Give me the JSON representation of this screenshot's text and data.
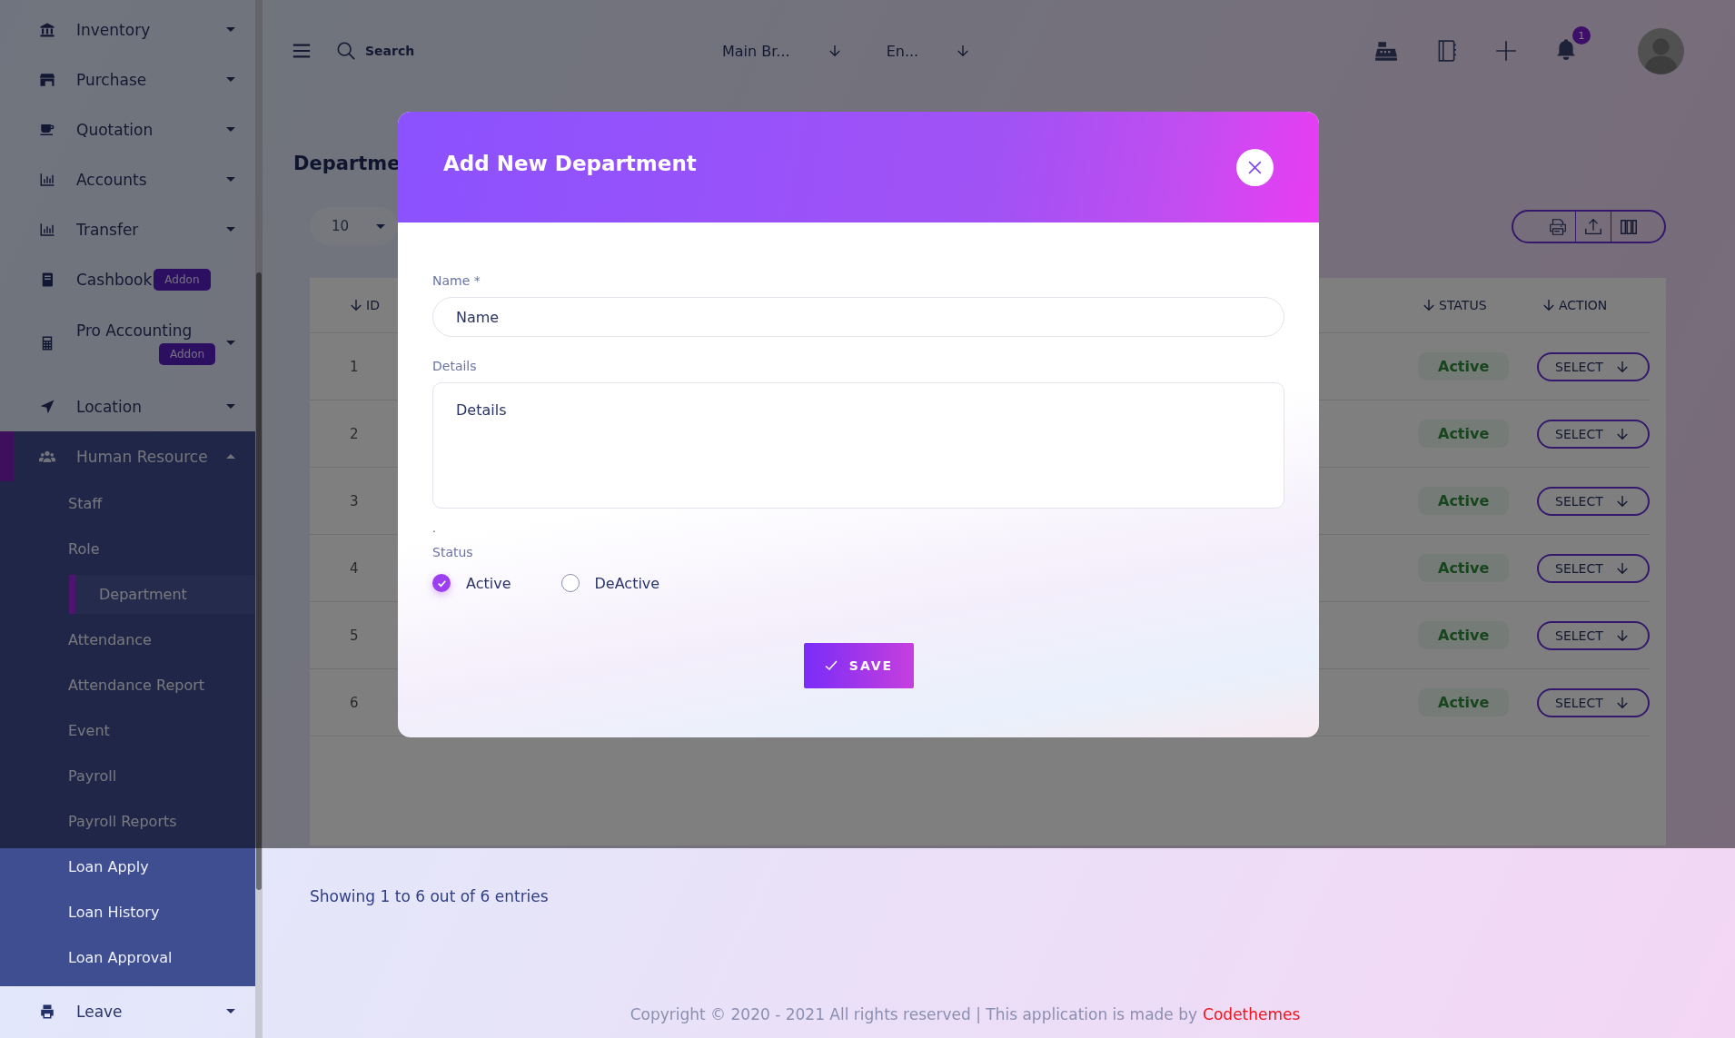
{
  "sidebar": {
    "items": [
      {
        "label": "Inventory",
        "kind": "menu",
        "expanded": false
      },
      {
        "label": "Purchase",
        "kind": "menu",
        "expanded": false
      },
      {
        "label": "Quotation",
        "kind": "menu",
        "expanded": false
      },
      {
        "label": "Accounts",
        "kind": "menu",
        "expanded": false
      },
      {
        "label": "Transfer",
        "kind": "menu",
        "expanded": false
      },
      {
        "label": "Cashbook",
        "kind": "link",
        "badge": "Addon"
      },
      {
        "label": "Pro Accounting",
        "kind": "menu",
        "expanded": false,
        "badge": "Addon"
      },
      {
        "label": "Location",
        "kind": "menu",
        "expanded": false
      },
      {
        "label": "Human Resource",
        "kind": "menu",
        "expanded": true,
        "children": [
          {
            "label": "Staff",
            "selected": false
          },
          {
            "label": "Role",
            "selected": false
          },
          {
            "label": "Department",
            "selected": true
          },
          {
            "label": "Attendance",
            "selected": false
          },
          {
            "label": "Attendance Report",
            "selected": false
          },
          {
            "label": "Event",
            "selected": false
          },
          {
            "label": "Payroll",
            "selected": false
          },
          {
            "label": "Payroll Reports",
            "selected": false
          },
          {
            "label": "Loan Apply",
            "selected": false
          },
          {
            "label": "Loan History",
            "selected": false
          },
          {
            "label": "Loan Approval",
            "selected": false
          }
        ]
      },
      {
        "label": "Leave",
        "kind": "menu",
        "expanded": false
      }
    ]
  },
  "topbar": {
    "search": {
      "placeholder": "Search"
    },
    "selects": [
      "Main Br...",
      "En..."
    ],
    "notification_count": "1"
  },
  "page_title": "Departme",
  "table": {
    "page_length": "10",
    "columns": [
      "ID",
      "STATUS",
      "ACTION"
    ],
    "rows": [
      {
        "id": "1",
        "status": "Active",
        "action": "SELECT"
      },
      {
        "id": "2",
        "status": "Active",
        "action": "SELECT"
      },
      {
        "id": "3",
        "status": "Active",
        "action": "SELECT"
      },
      {
        "id": "4",
        "status": "Active",
        "action": "SELECT"
      },
      {
        "id": "5",
        "status": "Active",
        "action": "SELECT"
      },
      {
        "id": "6",
        "status": "Active",
        "action": "SELECT"
      }
    ],
    "summary": "Showing 1 to 6 out of 6 entries"
  },
  "footer": {
    "text": "Copyright © 2020 - 2021 All rights reserved | This application is made by",
    "link": "Codethemes"
  },
  "modal": {
    "title": "Add New Department",
    "name_field": {
      "label": "Name *",
      "placeholder": "Name"
    },
    "details_field": {
      "label": "Details",
      "placeholder": "Details"
    },
    "note": ".",
    "status": {
      "label": "Status",
      "options": [
        {
          "label": "Active",
          "selected": true
        },
        {
          "label": "DeActive",
          "selected": false
        }
      ]
    },
    "save": "SAVE"
  }
}
